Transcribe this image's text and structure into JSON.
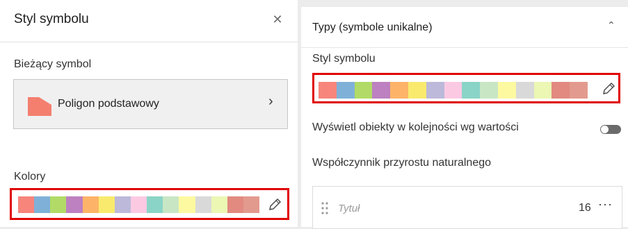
{
  "left_panel": {
    "title": "Styl symbolu",
    "close_icon": "close-icon",
    "current_symbol_label": "Bieżący symbol",
    "current_symbol": {
      "name": "Poligon podstawowy",
      "swatch_color": "#f47f6f",
      "chevron_icon": "chevron-right-icon"
    },
    "colors_label": "Kolory",
    "ramp_colors": [
      "#f7857b",
      "#7fb1d8",
      "#b1db66",
      "#bd80c0",
      "#fdb468",
      "#f9ea6e",
      "#bcb9da",
      "#fcc9e3",
      "#8ad4c7",
      "#c8e6c4",
      "#fdf9a1",
      "#d9d9d9",
      "#ebf7b3",
      "#e28a80",
      "#e39a8e"
    ]
  },
  "right_panel": {
    "title": "Typy (symbole unikalne)",
    "collapse_icon": "chevron-up-icon",
    "style_label": "Styl symbolu",
    "ramp_colors": [
      "#f7857b",
      "#7fb1d8",
      "#b1db66",
      "#bd80c0",
      "#fdb468",
      "#f9ea6e",
      "#bcb9da",
      "#fcc9e3",
      "#8ad4c7",
      "#c8e6c4",
      "#fdf9a1",
      "#d9d9d9",
      "#ebf7b3",
      "#e28a80",
      "#e39a8e"
    ],
    "order_label": "Wyświetl obiekty w kolejności wg wartości",
    "order_toggle_on": false,
    "field_label": "Współczynnik przyrostu naturalnego",
    "title_row": {
      "placeholder": "Tytuł",
      "count": "16",
      "more_label": "···"
    }
  },
  "colors": {
    "highlight": "#e00000",
    "toggle_track": "#6b6b6b"
  }
}
